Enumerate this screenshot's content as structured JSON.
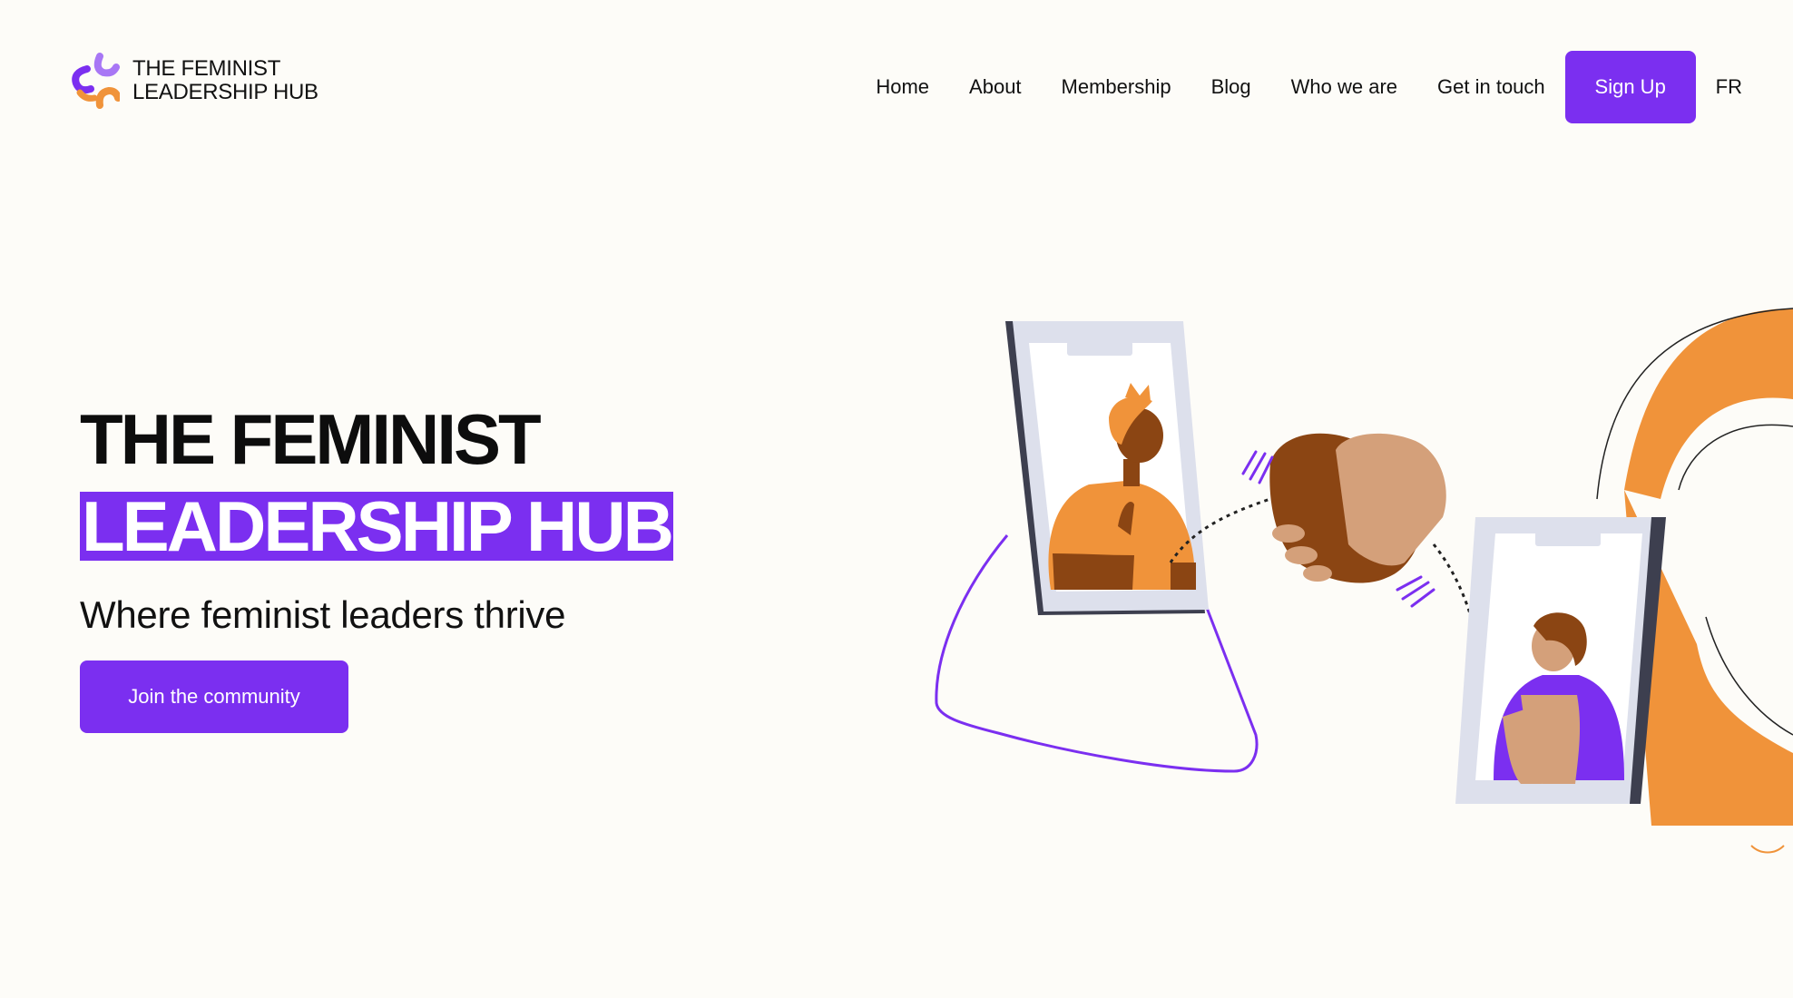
{
  "brand": {
    "logo_line1": "THE FEMINIST",
    "logo_line2": "LEADERSHIP HUB",
    "colors": {
      "purple": "#7b2ff0",
      "orange": "#f0933a",
      "background": "#fdfcf8"
    }
  },
  "nav": {
    "items": [
      "Home",
      "About",
      "Membership",
      "Blog",
      "Who we are",
      "Get in touch"
    ],
    "signup_label": "Sign Up",
    "language_label": "FR"
  },
  "hero": {
    "title_line1": "THE FEMINIST",
    "title_line2": "LEADERSHIP HUB",
    "tagline": "Where feminist leaders thrive",
    "cta_label": "Join the community"
  },
  "illustration": {
    "icons": [
      "phone-left-icon",
      "phone-right-icon",
      "handshake-icon",
      "person-orange-icon",
      "person-purple-icon"
    ]
  }
}
